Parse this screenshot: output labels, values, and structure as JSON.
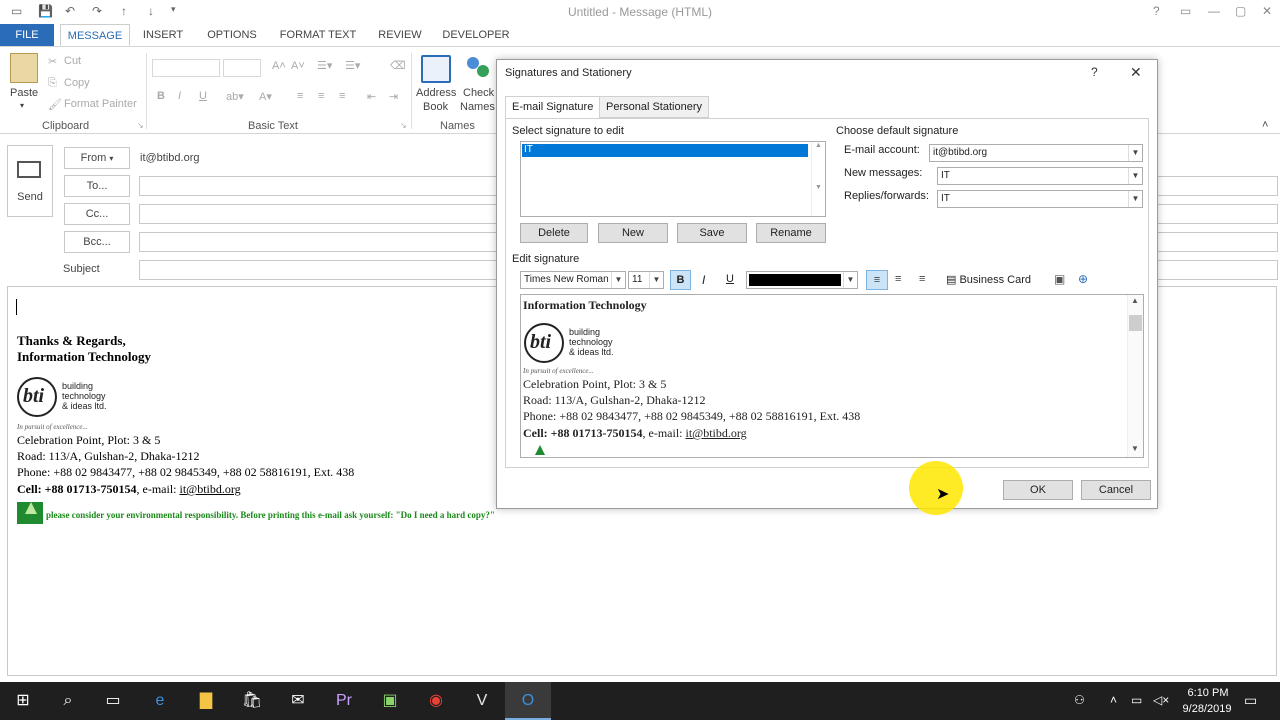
{
  "window": {
    "title": "Untitled - Message (HTML)",
    "quick_access": [
      "save-icon",
      "undo-icon",
      "redo-icon",
      "up-icon",
      "down-icon"
    ],
    "controls": [
      "?",
      "restore-ribbon-icon",
      "minimize-icon",
      "maximize-icon",
      "close-icon"
    ]
  },
  "ribbon_tabs": [
    "FILE",
    "MESSAGE",
    "INSERT",
    "OPTIONS",
    "FORMAT TEXT",
    "REVIEW",
    "DEVELOPER"
  ],
  "ribbon": {
    "clipboard": {
      "paste": "Paste",
      "cut": "Cut",
      "copy": "Copy",
      "format_painter": "Format Painter",
      "group": "Clipboard"
    },
    "basic_text": {
      "group": "Basic Text"
    },
    "names": {
      "address_book_line1": "Address",
      "address_book_line2": "Book",
      "check_names_line1": "Check",
      "check_names_line2": "Names",
      "group": "Names"
    }
  },
  "message": {
    "send": "Send",
    "from": "From",
    "from_value": "it@btibd.org",
    "to": "To...",
    "cc": "Cc...",
    "bcc": "Bcc...",
    "subject": "Subject"
  },
  "body_signature": {
    "regards": "Thanks & Regards,",
    "dept": "Information Technology",
    "logo_text": [
      "building",
      "technology",
      "& ideas ltd."
    ],
    "logo_mark": "bti",
    "tagline": "In pursuit of excellence...",
    "address1": "Celebration Point, Plot: 3 & 5",
    "address2": "Road: 113/A, Gulshan-2, Dhaka-1212",
    "phone": "Phone: +88 02 9843477, +88 02 9845349, +88 02 58816191, Ext. 438",
    "cell_label": "Cell: +88 01713-750154",
    "email_label": ", e-mail: ",
    "email": "it@btibd.org",
    "env_note": "please consider your environmental responsibility. Before printing this e-mail ask yourself: \"Do I need a hard copy?\""
  },
  "dialog": {
    "title": "Signatures and Stationery",
    "help": "?",
    "close": "✕",
    "tabs": [
      "E-mail Signature",
      "Personal Stationery"
    ],
    "select_label": "Select signature to edit",
    "signatures": [
      "IT"
    ],
    "buttons": {
      "delete": "Delete",
      "new": "New",
      "save": "Save",
      "rename": "Rename"
    },
    "default_label": "Choose default signature",
    "email_account_label": "E-mail account:",
    "email_account": "it@btibd.org",
    "new_messages_label": "New messages:",
    "new_messages": "IT",
    "replies_label": "Replies/forwards:",
    "replies": "IT",
    "edit_label": "Edit signature",
    "font": "Times New Roman",
    "size": "11",
    "bold": "B",
    "italic": "I",
    "underline": "U",
    "color": "#000000",
    "business_card": "Business Card",
    "ok": "OK",
    "cancel": "Cancel",
    "sig_title": "Information Technology"
  },
  "taskbar": {
    "time": "6:10 PM",
    "date": "9/28/2019"
  }
}
